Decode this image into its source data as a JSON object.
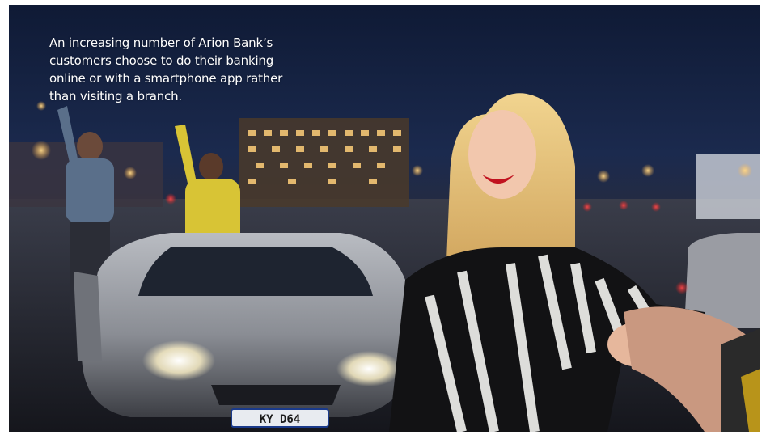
{
  "photo": {
    "caption": "An increasing number of Arion Bank’s customers choose to do their banking online or with a smartphone app rather than visiting a branch.",
    "subject": "smiling woman leading by the hand at night car park",
    "license_plate": "KY D64"
  }
}
